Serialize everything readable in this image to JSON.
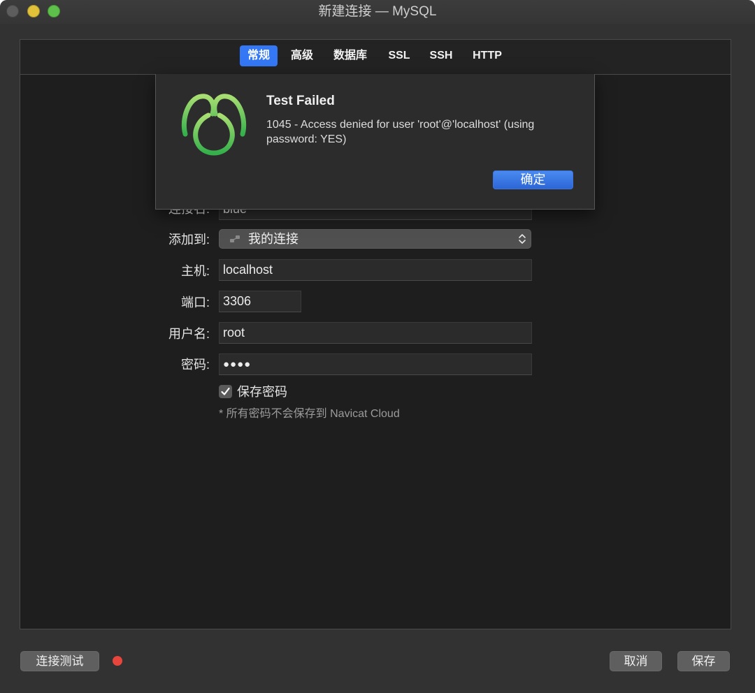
{
  "window": {
    "title": "新建连接 — MySQL",
    "traffic_lights": {
      "close": "#5d5d5d",
      "minimize": "#e1c03a",
      "zoom": "#5ec04b"
    }
  },
  "tabs": [
    {
      "label": "常规",
      "selected": true
    },
    {
      "label": "高级",
      "selected": false
    },
    {
      "label": "数据库",
      "selected": false
    },
    {
      "label": "SSL",
      "selected": false
    },
    {
      "label": "SSH",
      "selected": false
    },
    {
      "label": "HTTP",
      "selected": false
    }
  ],
  "form": {
    "connection_name": {
      "label": "连接名:",
      "value": "blue"
    },
    "add_to": {
      "label": "添加到:",
      "value": "我的连接",
      "icon": "connection-group-icon"
    },
    "host": {
      "label": "主机:",
      "value": "localhost"
    },
    "port": {
      "label": "端口:",
      "value": "3306"
    },
    "username": {
      "label": "用户名:",
      "value": "root"
    },
    "password": {
      "label": "密码:",
      "value": "●●●●"
    },
    "save_password": {
      "label": "保存密码",
      "checked": true
    },
    "note": "* 所有密码不会保存到 Navicat Cloud"
  },
  "alert": {
    "icon": "navicat-logo",
    "title": "Test Failed",
    "message": "1045 - Access denied for user 'root'@'localhost' (using password: YES)",
    "ok_label": "确定"
  },
  "footer": {
    "test_label": "连接测试",
    "status_color": "#e8453c",
    "cancel_label": "取消",
    "save_label": "保存"
  },
  "colors": {
    "accent": "#3478f6",
    "logo_green": "#5cc85a"
  }
}
